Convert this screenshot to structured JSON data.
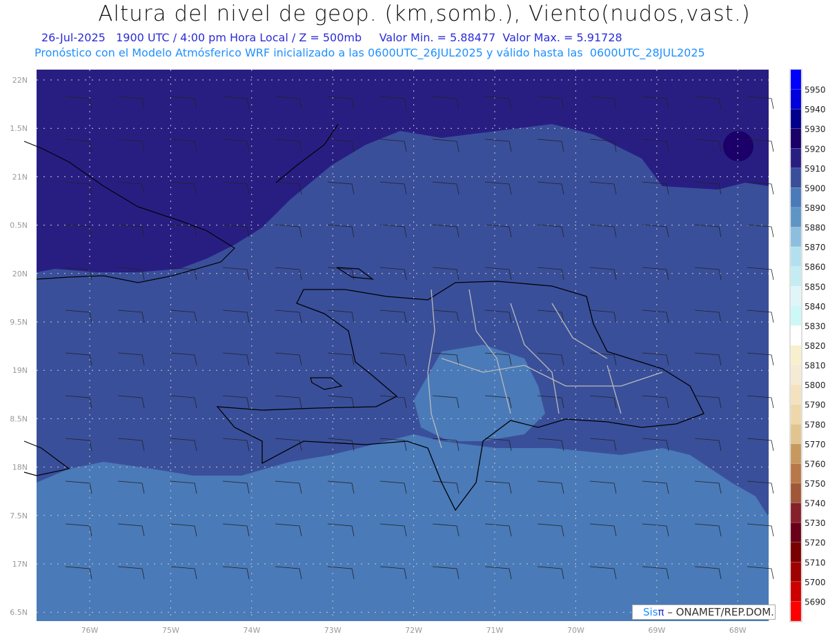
{
  "header": {
    "title": "Altura del nivel de geop. (km,somb.), Viento(nudos,vast.)",
    "line2": "26-Jul-2025   1900 UTC / 4:00 pm Hora Local / Z = 500mb     Valor Min. = 5.88477  Valor Max. = 5.91728",
    "line3": "Pronóstico con el Modelo Atmósferico WRF inicializado a las 0600UTC_26JUL2025 y válido hasta las  0600UTC_28JUL2025"
  },
  "axes": {
    "lon_labels": [
      "76W",
      "75W",
      "74W",
      "73W",
      "72W",
      "71W",
      "70W",
      "69W",
      "68W"
    ],
    "lat_labels": [
      "22N",
      "1.5N",
      "21N",
      "0.5N",
      "20N",
      "9.5N",
      "19N",
      "8.5N",
      "18N",
      "7.5N",
      "17N",
      "6.5N"
    ]
  },
  "colorbar": {
    "labels": [
      "5950",
      "5940",
      "5930",
      "5920",
      "5910",
      "5900",
      "5890",
      "5880",
      "5870",
      "5860",
      "5850",
      "5840",
      "5830",
      "5820",
      "5810",
      "5800",
      "5790",
      "5780",
      "5770",
      "5760",
      "5750",
      "5740",
      "5730",
      "5720",
      "5710",
      "5700",
      "5690"
    ],
    "colors": [
      "#0000ff",
      "#0000dd",
      "#00008b",
      "#1a0068",
      "#281e82",
      "#3a4f9a",
      "#4a7ab8",
      "#5f95c5",
      "#8cbfdf",
      "#b3e0ee",
      "#c4ecf3",
      "#dff5f8",
      "#ccf8f8",
      "#ffffff",
      "#f8f0cc",
      "#f5ead4",
      "#f3e2bd",
      "#eed8aa",
      "#e2c48e",
      "#c8995e",
      "#b87848",
      "#a05838",
      "#86202a",
      "#6a0018",
      "#7a0000",
      "#a00000",
      "#cc0000",
      "#ff0000"
    ]
  },
  "logo": {
    "sis": "Sis",
    "pi": "π",
    "rest": " – ONAMET/REP.DOM."
  }
}
